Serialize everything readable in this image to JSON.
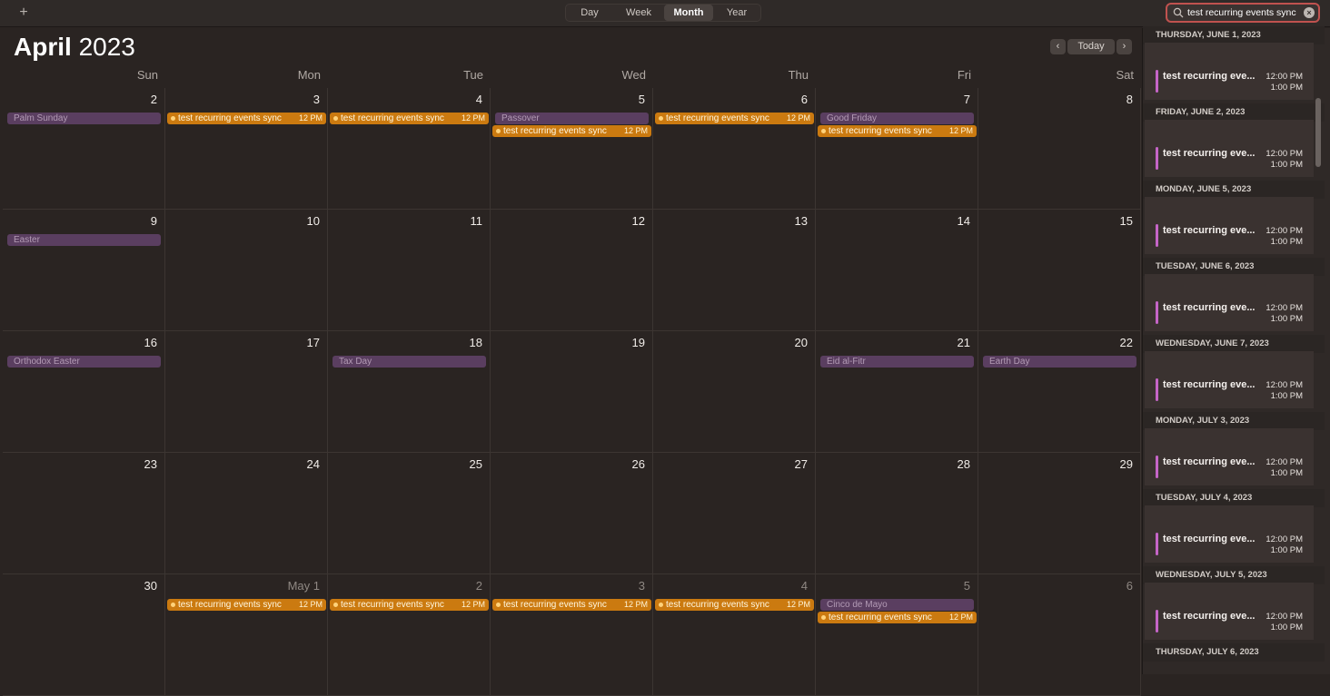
{
  "toolbar": {
    "add_label": "+",
    "views": [
      "Day",
      "Week",
      "Month",
      "Year"
    ],
    "active_view": "Month",
    "search_value": "test recurring events sync"
  },
  "header": {
    "month": "April",
    "year": "2023",
    "today_label": "Today",
    "prev_icon": "chevron-left-icon",
    "next_icon": "chevron-right-icon"
  },
  "weekdays": [
    "Sun",
    "Mon",
    "Tue",
    "Wed",
    "Thu",
    "Fri",
    "Sat"
  ],
  "weeks": [
    [
      "2",
      "3",
      "4",
      "5",
      "6",
      "7",
      "8"
    ],
    [
      "9",
      "10",
      "11",
      "12",
      "13",
      "14",
      "15"
    ],
    [
      "16",
      "17",
      "18",
      "19",
      "20",
      "21",
      "22"
    ],
    [
      "23",
      "24",
      "25",
      "26",
      "27",
      "28",
      "29"
    ],
    [
      "30",
      "May 1",
      "2",
      "3",
      "4",
      "5",
      "6"
    ]
  ],
  "holidays": [
    {
      "week": 0,
      "day": 0,
      "label": "Palm Sunday"
    },
    {
      "week": 0,
      "day": 3,
      "label": "Passover"
    },
    {
      "week": 0,
      "day": 5,
      "label": "Good Friday"
    },
    {
      "week": 1,
      "day": 0,
      "label": "Easter"
    },
    {
      "week": 2,
      "day": 0,
      "label": "Orthodox Easter"
    },
    {
      "week": 2,
      "day": 2,
      "label": "Tax Day"
    },
    {
      "week": 2,
      "day": 5,
      "label": "Eid al-Fitr"
    },
    {
      "week": 2,
      "day": 6,
      "label": "Earth Day"
    },
    {
      "week": 4,
      "day": 5,
      "label": "Cinco de Mayo"
    }
  ],
  "event_label": "test recurring events sync",
  "event_time": "12 PM",
  "recurring": [
    {
      "week": 0,
      "day": 1,
      "row": 0,
      "color": "orange"
    },
    {
      "week": 0,
      "day": 2,
      "row": 0,
      "color": "orange"
    },
    {
      "week": 0,
      "day": 3,
      "row": 1,
      "color": "orange"
    },
    {
      "week": 0,
      "day": 4,
      "row": 0,
      "color": "orange"
    },
    {
      "week": 0,
      "day": 5,
      "row": 1,
      "color": "orange"
    },
    {
      "week": 4,
      "day": 1,
      "row": 0,
      "color": "orange"
    },
    {
      "week": 4,
      "day": 2,
      "row": 0,
      "color": "orange"
    },
    {
      "week": 4,
      "day": 3,
      "row": 0,
      "color": "orange"
    },
    {
      "week": 4,
      "day": 4,
      "row": 0,
      "color": "orange"
    },
    {
      "week": 4,
      "day": 5,
      "row": 1,
      "color": "orange"
    }
  ],
  "sidebar": {
    "results": [
      {
        "date": "THURSDAY, JUNE 1, 2023",
        "title": "test recurring eve...",
        "start": "12:00 PM",
        "end": "1:00 PM"
      },
      {
        "date": "FRIDAY, JUNE 2, 2023",
        "title": "test recurring eve...",
        "start": "12:00 PM",
        "end": "1:00 PM"
      },
      {
        "date": "MONDAY, JUNE 5, 2023",
        "title": "test recurring eve...",
        "start": "12:00 PM",
        "end": "1:00 PM"
      },
      {
        "date": "TUESDAY, JUNE 6, 2023",
        "title": "test recurring eve...",
        "start": "12:00 PM",
        "end": "1:00 PM"
      },
      {
        "date": "WEDNESDAY, JUNE 7, 2023",
        "title": "test recurring eve...",
        "start": "12:00 PM",
        "end": "1:00 PM"
      },
      {
        "date": "MONDAY, JULY 3, 2023",
        "title": "test recurring eve...",
        "start": "12:00 PM",
        "end": "1:00 PM"
      },
      {
        "date": "TUESDAY, JULY 4, 2023",
        "title": "test recurring eve...",
        "start": "12:00 PM",
        "end": "1:00 PM"
      },
      {
        "date": "WEDNESDAY, JULY 5, 2023",
        "title": "test recurring eve...",
        "start": "12:00 PM",
        "end": "1:00 PM"
      },
      {
        "date": "THURSDAY, JULY 6, 2023"
      }
    ]
  }
}
